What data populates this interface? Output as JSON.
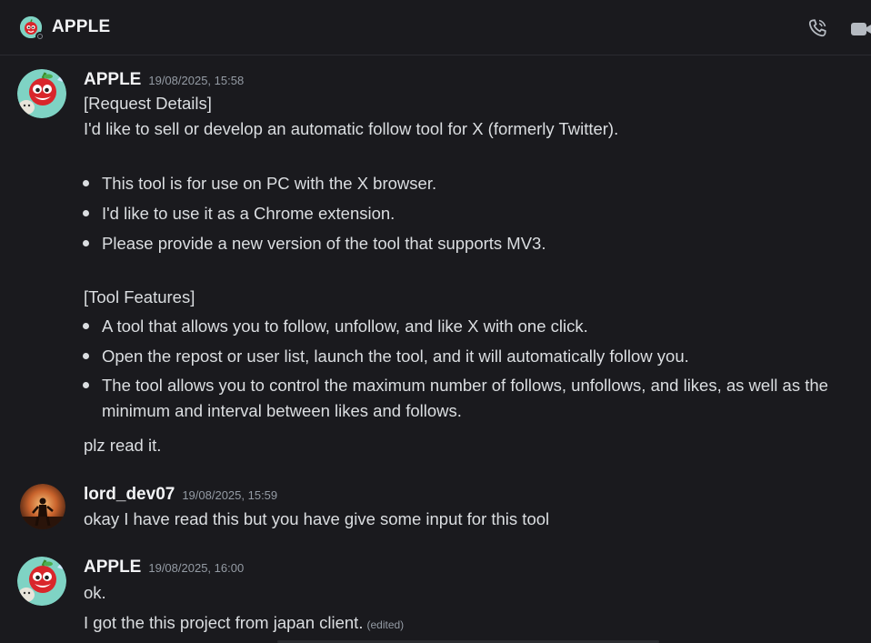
{
  "header": {
    "title": "APPLE",
    "icons": [
      "voice-call-icon",
      "video-call-icon"
    ]
  },
  "messages": [
    {
      "author": "APPLE",
      "timestamp": "19/08/2025, 15:58",
      "lines": [
        "[Request Details]",
        "I'd like to sell or develop an automatic follow tool for X (formerly Twitter)."
      ],
      "bullets1": [
        "This tool is for use on PC with the X browser.",
        "I'd like to use it as a Chrome extension.",
        "Please provide a new version of the tool that supports MV3."
      ],
      "section2": "[Tool Features]",
      "bullets2": [
        "A tool that allows you to follow, unfollow, and like X with one click.",
        "Open the repost or user list, launch the tool, and it will automatically follow you.",
        "The tool allows you to control the maximum number of follows, unfollows, and likes, as well as the",
        "minimum and interval between likes and follows."
      ],
      "closing": "plz read it."
    },
    {
      "author": "lord_dev07",
      "timestamp": "19/08/2025, 15:59",
      "lines": [
        "okay I have read this but you have give some input for this tool"
      ]
    },
    {
      "author": "APPLE",
      "timestamp": "19/08/2025, 16:00",
      "lines": [
        "ok.",
        "I got the this project from japan client."
      ],
      "edited": "(edited)"
    }
  ],
  "colors": {
    "background": "#1a1a1e",
    "text": "#dbdee1",
    "author": "#f2f3f5",
    "muted": "#949ba4"
  }
}
